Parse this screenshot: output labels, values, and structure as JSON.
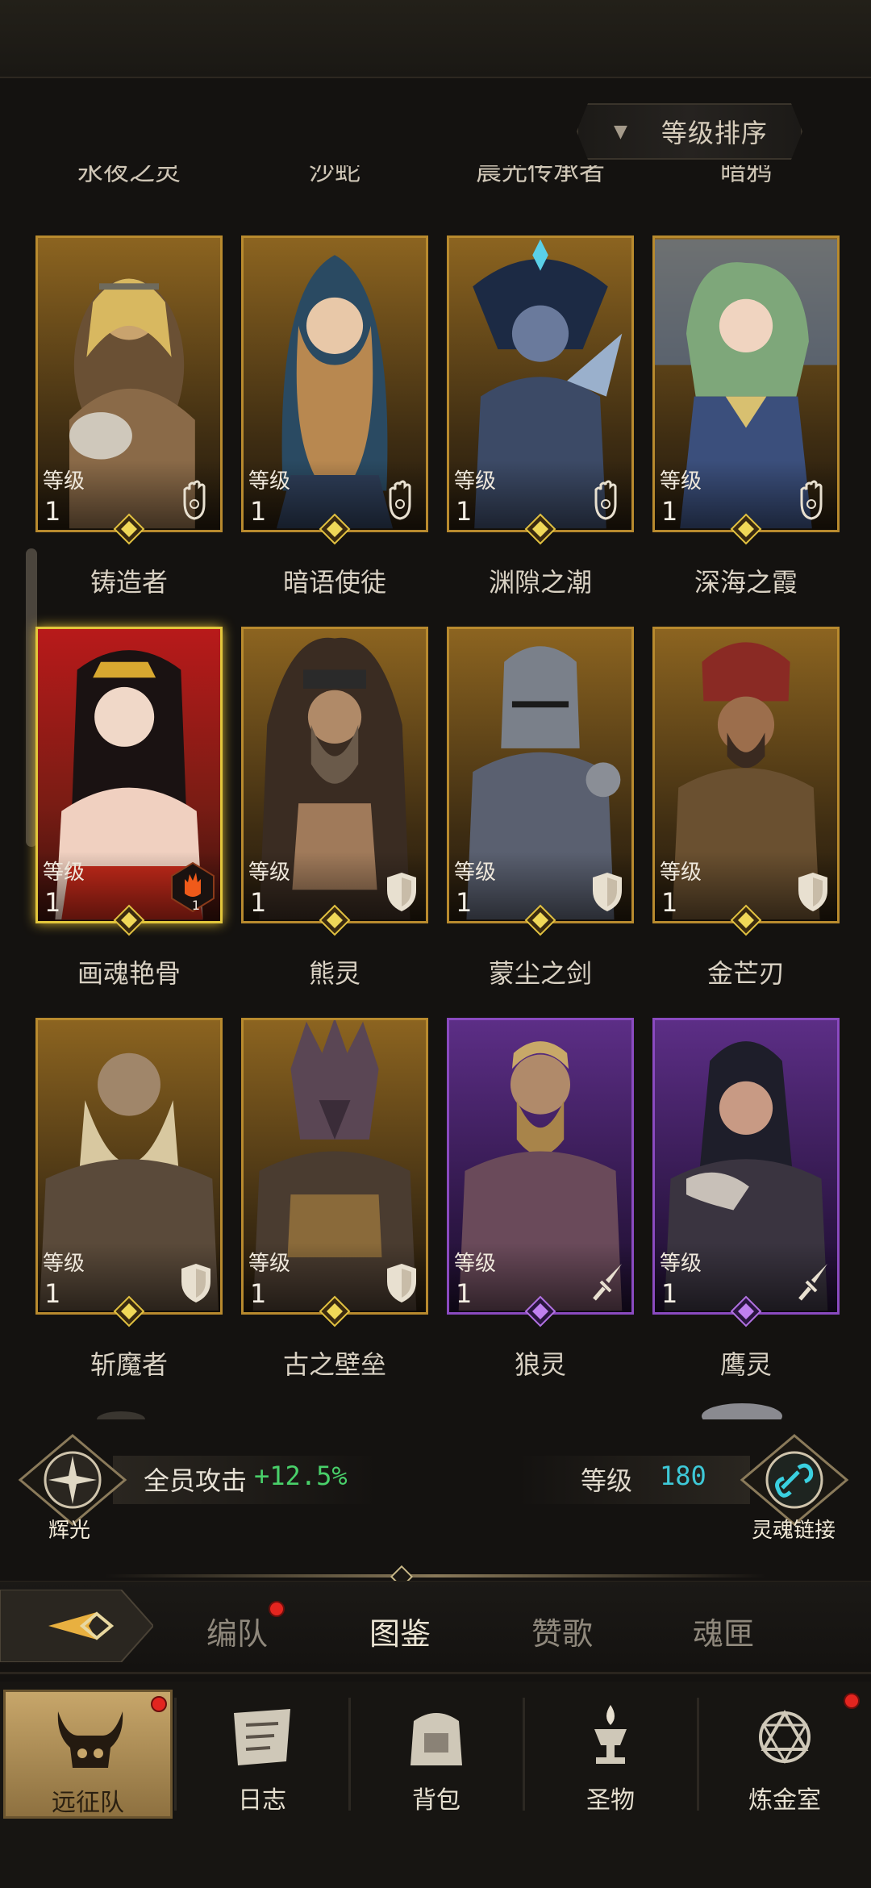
{
  "sort_button": {
    "label": "等级排序"
  },
  "partial_top_names": [
    "永夜之灵",
    "沙蛇",
    "晨光传承者",
    "暗鸦"
  ],
  "heroes": [
    {
      "name": "铸造者",
      "level_label": "等级",
      "level": "1",
      "frame": "gold",
      "role_icon": "hand-icon"
    },
    {
      "name": "暗语使徒",
      "level_label": "等级",
      "level": "1",
      "frame": "gold",
      "role_icon": "hand-icon"
    },
    {
      "name": "渊隙之潮",
      "level_label": "等级",
      "level": "1",
      "frame": "gold",
      "role_icon": "hand-icon"
    },
    {
      "name": "深海之霞",
      "level_label": "等级",
      "level": "1",
      "frame": "gold",
      "role_icon": "hand-icon"
    },
    {
      "name": "画魂艳骨",
      "level_label": "等级",
      "level": "1",
      "frame": "red-glow",
      "role_icon": "flame-hand-badge-icon",
      "badge_count": "1"
    },
    {
      "name": "熊灵",
      "level_label": "等级",
      "level": "1",
      "frame": "gold",
      "role_icon": "shield-icon"
    },
    {
      "name": "蒙尘之剑",
      "level_label": "等级",
      "level": "1",
      "frame": "gold",
      "role_icon": "shield-icon"
    },
    {
      "name": "金芒刃",
      "level_label": "等级",
      "level": "1",
      "frame": "gold",
      "role_icon": "shield-icon"
    },
    {
      "name": "斩魔者",
      "level_label": "等级",
      "level": "1",
      "frame": "gold",
      "role_icon": "shield-icon"
    },
    {
      "name": "古之壁垒",
      "level_label": "等级",
      "level": "1",
      "frame": "gold",
      "role_icon": "shield-icon"
    },
    {
      "name": "狼灵",
      "level_label": "等级",
      "level": "1",
      "frame": "purple",
      "role_icon": "sword-icon"
    },
    {
      "name": "鹰灵",
      "level_label": "等级",
      "level": "1",
      "frame": "purple",
      "role_icon": "sword-icon"
    }
  ],
  "bonus": {
    "radiance_label": "辉光",
    "attack_label": "全员攻击",
    "attack_value": "+12.5%",
    "level_label": "等级",
    "level_value": "180",
    "soul_link_label": "灵魂链接"
  },
  "tabs": [
    {
      "label": "编队",
      "active": false,
      "has_dot": true
    },
    {
      "label": "图鉴",
      "active": true,
      "has_dot": false
    },
    {
      "label": "赞歌",
      "active": false,
      "has_dot": false
    },
    {
      "label": "魂匣",
      "active": false,
      "has_dot": false
    }
  ],
  "nav": [
    {
      "label": "远征队",
      "icon": "horned-helmet-icon",
      "active": true,
      "has_dot": true
    },
    {
      "label": "日志",
      "icon": "scroll-icon",
      "active": false,
      "has_dot": false
    },
    {
      "label": "背包",
      "icon": "backpack-icon",
      "active": false,
      "has_dot": false
    },
    {
      "label": "圣物",
      "icon": "grail-icon",
      "active": false,
      "has_dot": false
    },
    {
      "label": "炼金室",
      "icon": "alchemy-icon",
      "active": false,
      "has_dot": true
    }
  ],
  "colors": {
    "gold_frame": "#b88a2e",
    "purple_frame": "#8a4ac0",
    "attack_green": "#49d06a",
    "level_cyan": "#3ec9d8",
    "red_dot": "#e3251f"
  }
}
